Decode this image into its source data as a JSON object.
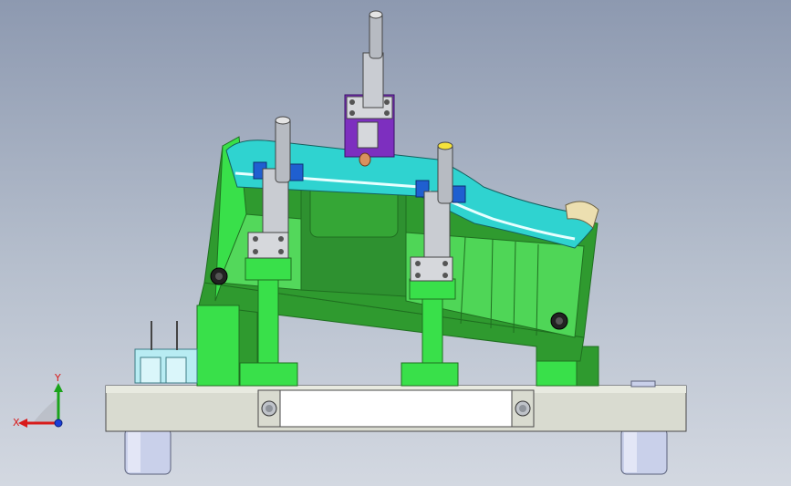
{
  "viewport": {
    "background_top": "#8d99b0",
    "background_bottom": "#d3d8e1"
  },
  "colors": {
    "green_main": "#2f9a2f",
    "green_light": "#39e04a",
    "green_dark": "#1f6f20",
    "cyan_part": "#2fd3d0",
    "purple_block": "#7d2fbf",
    "base_plate": "#d9dbd0",
    "clamp_metal": "#c9ccd2",
    "feet": "#c9d0ea"
  },
  "view_triad": {
    "x_label": "X",
    "y_label": "Y"
  }
}
